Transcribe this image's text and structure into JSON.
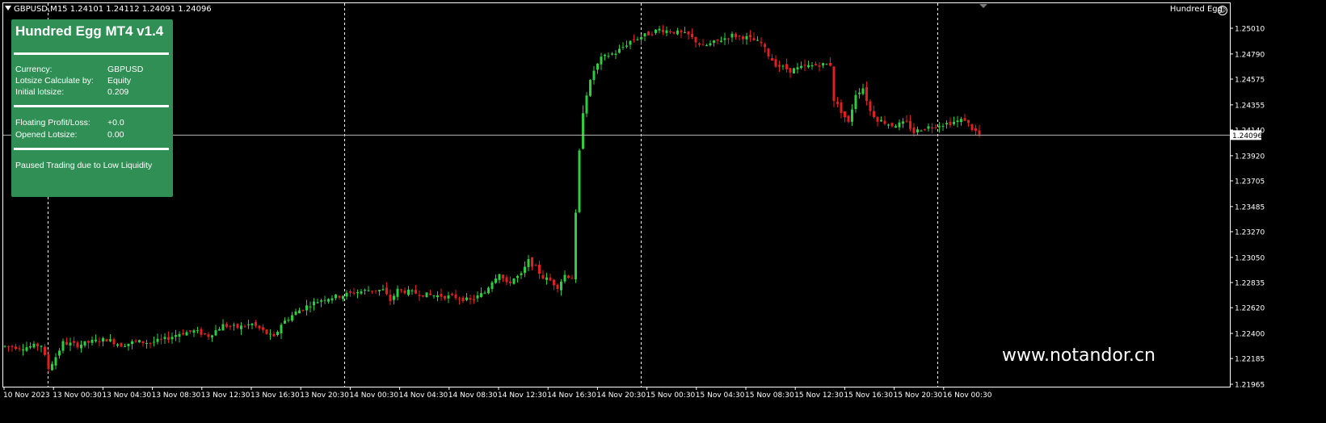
{
  "symbol_info": "GBPUSD,M15  1.24101 1.24112 1.24091 1.24096",
  "ea_label": "Hundred Egg",
  "ea_icon": "smiley-icon",
  "panel": {
    "title": "Hundred Egg MT4 v1.4",
    "currency_label": "Currency:",
    "currency_value": "GBPUSD",
    "lotsize_calc_label": "Lotsize Calculate by:",
    "lotsize_calc_value": "Equity",
    "initial_lotsize_label": "Initial lotsize:",
    "initial_lotsize_value": "0.209",
    "floating_pl_label": "Floating Profit/Loss:",
    "floating_pl_value": "+0.0",
    "opened_lotsize_label": "Opened Lotsize:",
    "opened_lotsize_value": "0.00",
    "status_text": "Paused Trading due to Low Liquidity",
    "bg_color": "#2f8f54"
  },
  "watermark": "www.notandor.cn",
  "chart_data": {
    "type": "candlestick",
    "symbol": "GBPUSD",
    "timeframe": "M15",
    "current_price": "1.24096",
    "ylim": [
      1.2188,
      1.2515
    ],
    "y_ticks": [
      "1.25010",
      "1.24790",
      "1.24575",
      "1.24355",
      "1.24140",
      "1.23920",
      "1.23705",
      "1.23485",
      "1.23270",
      "1.23050",
      "1.22835",
      "1.22620",
      "1.22400",
      "1.22185",
      "1.21965"
    ],
    "x_labels": [
      "10 Nov 2023",
      "13 Nov 00:30",
      "13 Nov 04:30",
      "13 Nov 08:30",
      "13 Nov 12:30",
      "13 Nov 16:30",
      "13 Nov 20:30",
      "14 Nov 00:30",
      "14 Nov 04:30",
      "14 Nov 08:30",
      "14 Nov 12:30",
      "14 Nov 16:30",
      "14 Nov 20:30",
      "15 Nov 00:30",
      "15 Nov 04:30",
      "15 Nov 08:30",
      "15 Nov 12:30",
      "15 Nov 16:30",
      "15 Nov 20:30",
      "16 Nov 00:30"
    ],
    "day_separators": [
      "13 Nov 00:00",
      "14 Nov 00:00",
      "15 Nov 00:00",
      "16 Nov 00:00"
    ],
    "price_path": [
      [
        0,
        1.2229
      ],
      [
        5,
        1.2228
      ],
      [
        10,
        1.223
      ],
      [
        12,
        1.221
      ],
      [
        14,
        1.222
      ],
      [
        16,
        1.2232
      ],
      [
        20,
        1.223
      ],
      [
        24,
        1.2233
      ],
      [
        28,
        1.2235
      ],
      [
        32,
        1.223
      ],
      [
        36,
        1.2233
      ],
      [
        40,
        1.2232
      ],
      [
        44,
        1.2235
      ],
      [
        48,
        1.224
      ],
      [
        52,
        1.2242
      ],
      [
        56,
        1.2238
      ],
      [
        60,
        1.2247
      ],
      [
        64,
        1.2245
      ],
      [
        68,
        1.2248
      ],
      [
        72,
        1.224
      ],
      [
        74,
        1.2236
      ],
      [
        76,
        1.2248
      ],
      [
        80,
        1.2258
      ],
      [
        84,
        1.2265
      ],
      [
        88,
        1.227
      ],
      [
        92,
        1.2272
      ],
      [
        96,
        1.2275
      ],
      [
        100,
        1.2277
      ],
      [
        104,
        1.2277
      ],
      [
        106,
        1.2268
      ],
      [
        108,
        1.2277
      ],
      [
        112,
        1.2275
      ],
      [
        116,
        1.2273
      ],
      [
        120,
        1.2272
      ],
      [
        124,
        1.2271
      ],
      [
        128,
        1.2268
      ],
      [
        132,
        1.2275
      ],
      [
        134,
        1.2285
      ],
      [
        136,
        1.2292
      ],
      [
        138,
        1.2282
      ],
      [
        140,
        1.2287
      ],
      [
        142,
        1.229
      ],
      [
        144,
        1.2302
      ],
      [
        146,
        1.2296
      ],
      [
        148,
        1.2288
      ],
      [
        150,
        1.2285
      ],
      [
        152,
        1.228
      ],
      [
        154,
        1.229
      ],
      [
        156,
        1.2288
      ],
      [
        158,
        1.2395
      ],
      [
        159,
        1.243
      ],
      [
        160,
        1.2445
      ],
      [
        162,
        1.2465
      ],
      [
        164,
        1.2475
      ],
      [
        166,
        1.2478
      ],
      [
        168,
        1.248
      ],
      [
        172,
        1.249
      ],
      [
        176,
        1.2495
      ],
      [
        180,
        1.25
      ],
      [
        184,
        1.2498
      ],
      [
        188,
        1.2495
      ],
      [
        192,
        1.2485
      ],
      [
        196,
        1.249
      ],
      [
        200,
        1.2495
      ],
      [
        204,
        1.2493
      ],
      [
        208,
        1.2488
      ],
      [
        210,
        1.2478
      ],
      [
        212,
        1.247
      ],
      [
        216,
        1.2465
      ],
      [
        220,
        1.2468
      ],
      [
        224,
        1.247
      ],
      [
        227,
        1.247
      ],
      [
        228,
        1.244
      ],
      [
        230,
        1.243
      ],
      [
        232,
        1.242
      ],
      [
        234,
        1.2445
      ],
      [
        236,
        1.245
      ],
      [
        238,
        1.243
      ],
      [
        240,
        1.2423
      ],
      [
        244,
        1.2418
      ],
      [
        248,
        1.242
      ],
      [
        250,
        1.2412
      ],
      [
        252,
        1.2415
      ],
      [
        256,
        1.2418
      ],
      [
        260,
        1.242
      ],
      [
        264,
        1.2423
      ],
      [
        266,
        1.2415
      ],
      [
        268,
        1.241
      ]
    ]
  }
}
